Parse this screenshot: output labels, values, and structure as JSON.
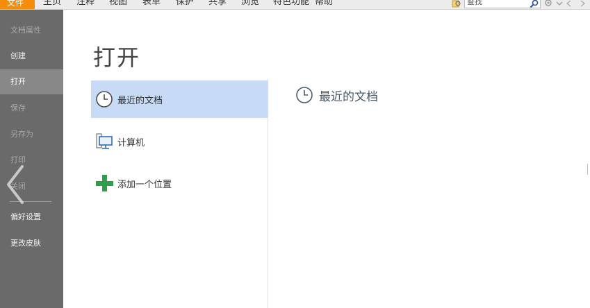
{
  "menubar": {
    "file_label": "文件",
    "tabs": [
      "主页",
      "注释",
      "视图",
      "表单",
      "保护",
      "共享",
      "浏览",
      "特色功能",
      "帮助"
    ],
    "search_placeholder": "查找"
  },
  "sidebar": {
    "items": [
      {
        "label": "文档属性",
        "state": "dim"
      },
      {
        "label": "创建",
        "state": "normal"
      },
      {
        "label": "打开",
        "state": "active"
      },
      {
        "label": "保存",
        "state": "dim"
      },
      {
        "label": "另存为",
        "state": "dim"
      },
      {
        "label": "打印",
        "state": "dim"
      },
      {
        "label": "关闭",
        "state": "dim"
      },
      {
        "label": "偏好设置",
        "state": "normal"
      },
      {
        "label": "更改皮肤",
        "state": "normal"
      }
    ]
  },
  "main": {
    "title": "打开",
    "locations": [
      {
        "label": "最近的文档",
        "icon": "clock-icon",
        "selected": true
      },
      {
        "label": "计算机",
        "icon": "computer-icon",
        "selected": false
      },
      {
        "label": "添加一个位置",
        "icon": "plus-icon",
        "selected": false
      }
    ],
    "right_title": "最近的文档"
  },
  "colors": {
    "accent": "#f58d0b",
    "sidebar_bg": "#6a6a6a",
    "selected_bg": "#c7daf6",
    "plus_green": "#2e9e4a"
  }
}
